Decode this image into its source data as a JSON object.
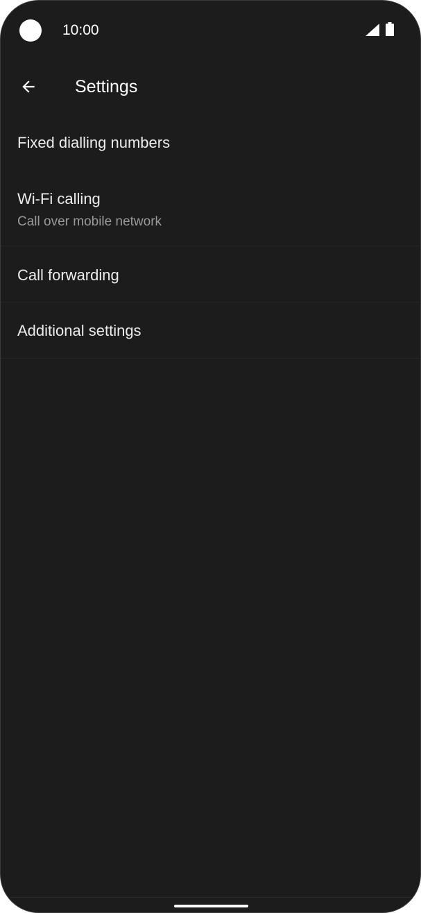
{
  "status_bar": {
    "time": "10:00",
    "icons": [
      "camera-cutout",
      "signal-icon",
      "battery-icon"
    ]
  },
  "app_bar": {
    "back_icon": "arrow-back-icon",
    "title": "Settings"
  },
  "settings_list": [
    {
      "title": "Fixed dialling numbers"
    },
    {
      "title": "Wi-Fi calling",
      "subtitle": "Call over mobile network"
    },
    {
      "title": "Call forwarding"
    },
    {
      "title": "Additional settings"
    }
  ],
  "colors": {
    "background": "#1c1c1c",
    "text_primary": "#ececec",
    "text_secondary": "#9a9a9a",
    "divider": "#262626"
  }
}
